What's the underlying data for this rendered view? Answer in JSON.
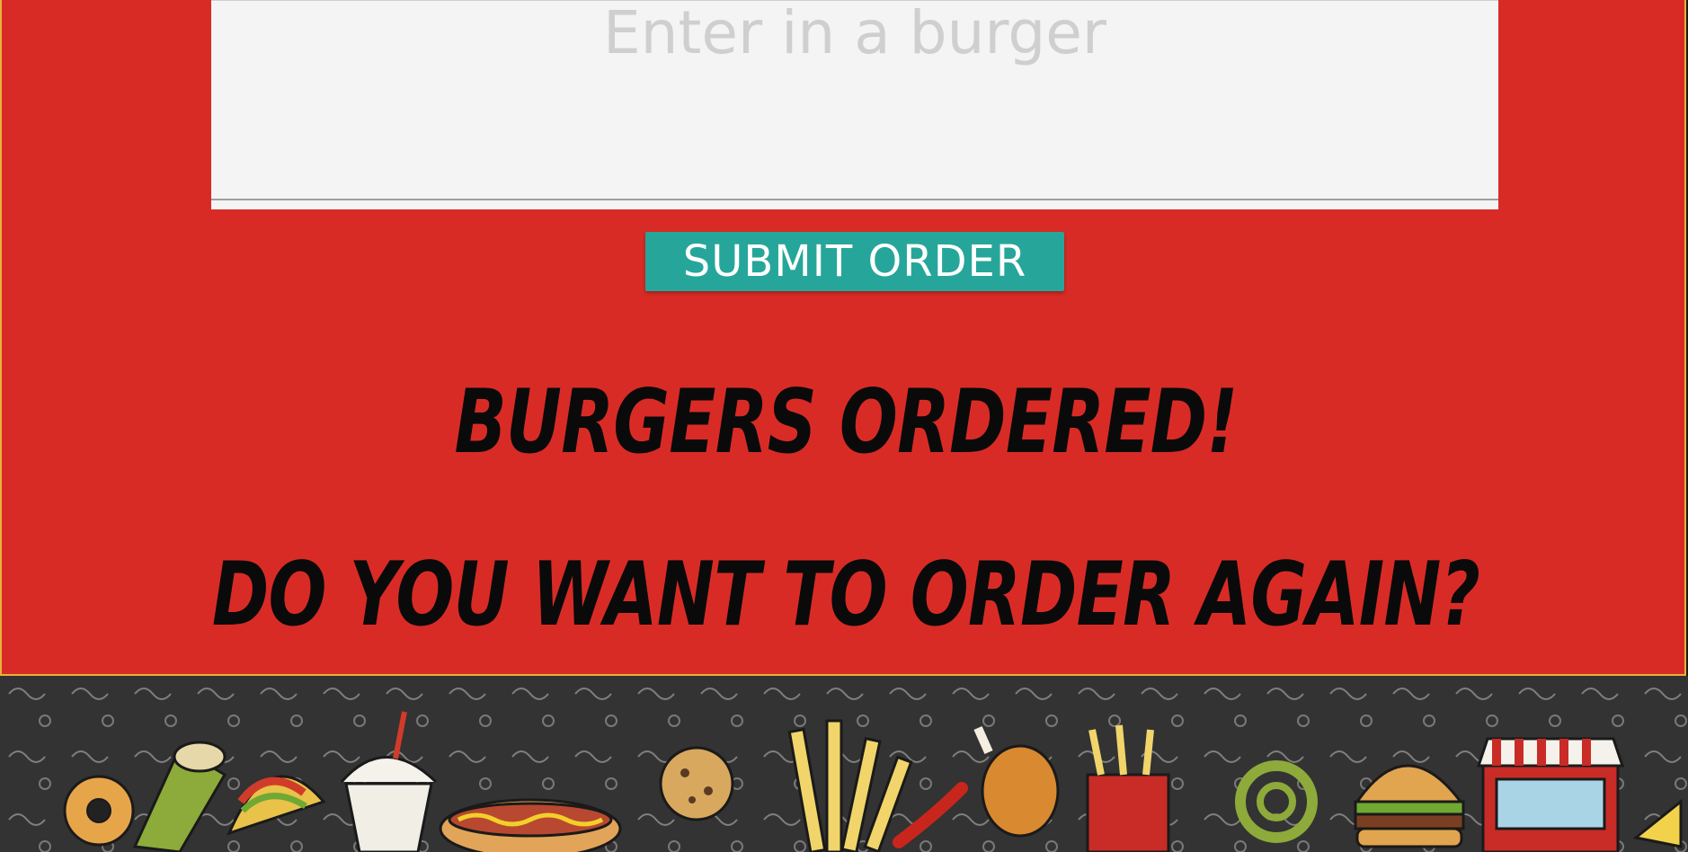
{
  "order_form": {
    "input_placeholder": "Enter in a burger",
    "input_value": "",
    "submit_label": "SUBMIT ORDER"
  },
  "messages": {
    "ordered": "Burgers Ordered!",
    "order_again": "Do you want to order again?"
  },
  "colors": {
    "panel_background": "#d92b26",
    "panel_border": "#e8b23a",
    "button": "#26a69a",
    "banner_background": "#3a3a3a"
  }
}
